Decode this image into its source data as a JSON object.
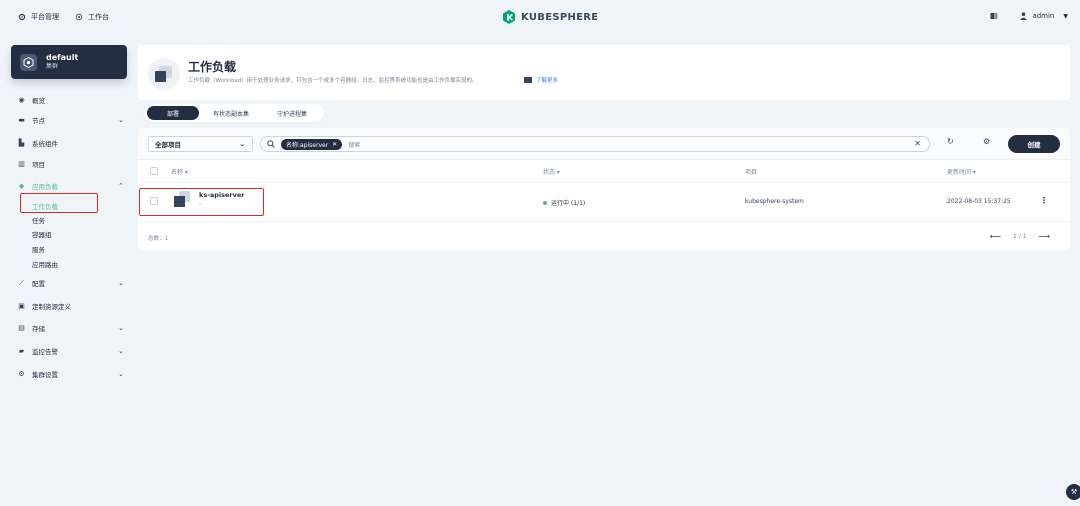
{
  "topbar": {
    "platform_label": "平台管理",
    "workbench_label": "工作台",
    "brand": "KUBESPHERE",
    "user": "admin"
  },
  "cluster": {
    "name": "default",
    "sub": "集群"
  },
  "nav": {
    "overview": "概览",
    "nodes": "节点",
    "components": "系统组件",
    "projects": "项目",
    "app_workloads": "应用负载",
    "sub": [
      "工作负载",
      "任务",
      "容器组",
      "服务",
      "应用路由"
    ],
    "config": "配置",
    "crd": "定制资源定义",
    "storage": "存储",
    "monitoring": "监控告警",
    "settings": "集群设置"
  },
  "header": {
    "title": "工作负载",
    "desc": "工作负载（Workload）用于处理业务请求，可包含一个或多个容器组。日志、监控等系统功能也是由工作负载实现的。",
    "learn_more": "了解更多"
  },
  "tabs": [
    "部署",
    "有状态副本集",
    "守护进程集"
  ],
  "toolbar": {
    "project_select": "全部项目",
    "filter_tag": "名称:apiserver",
    "search_placeholder": "搜索",
    "create": "创建"
  },
  "table": {
    "columns": [
      "名称",
      "状态",
      "项目",
      "更新时间"
    ],
    "rows": [
      {
        "name": "ks-apiserver",
        "sub": "-",
        "status": "运行中 (1/1)",
        "project": "kubesphere-system",
        "updated": "2022-08-03 15:37:25"
      }
    ]
  },
  "footer": {
    "total": "总数：1",
    "page": "1 / 1"
  },
  "colors": {
    "accent": "#55bc8a",
    "dark": "#242e42",
    "highlight": "#e0291f"
  }
}
